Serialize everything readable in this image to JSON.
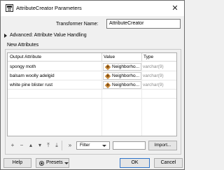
{
  "window": {
    "title": "AttributeCreator Parameters",
    "close_glyph": "✕",
    "app_icon": "form-window-icon"
  },
  "transformer": {
    "label": "Transformer Name:",
    "value": "AttributeCreator"
  },
  "advanced": {
    "label": "Advanced: Attribute Value Handling"
  },
  "new_attributes": {
    "label": "New Attributes",
    "columns": [
      "Output Attribute",
      "Value",
      "Type"
    ],
    "rows": [
      {
        "attribute": "spongy moth",
        "value": "Neighborho...",
        "type": "varchar(9)"
      },
      {
        "attribute": "balsam woolly adelgid",
        "value": "Neighborho...",
        "type": "varchar(9)"
      },
      {
        "attribute": "white pine blister rust",
        "value": "Neighborho...",
        "type": "varchar(9)"
      }
    ],
    "value_icon": "attribute-value-icon"
  },
  "toolbar": {
    "add": "+",
    "remove": "−",
    "move_up": "▴",
    "move_down": "▾",
    "move_top": "⤒",
    "move_bottom": "⤓",
    "more": "»",
    "filter_label": "Filter",
    "filter_value": "",
    "import_label": "Import..."
  },
  "footer": {
    "help": "Help",
    "presets": "Presets",
    "ok": "OK",
    "cancel": "Cancel"
  },
  "colors": {
    "ok_border": "#2f74c9",
    "type_text": "#8a8a8a",
    "value_icon": "#c98a3a"
  }
}
